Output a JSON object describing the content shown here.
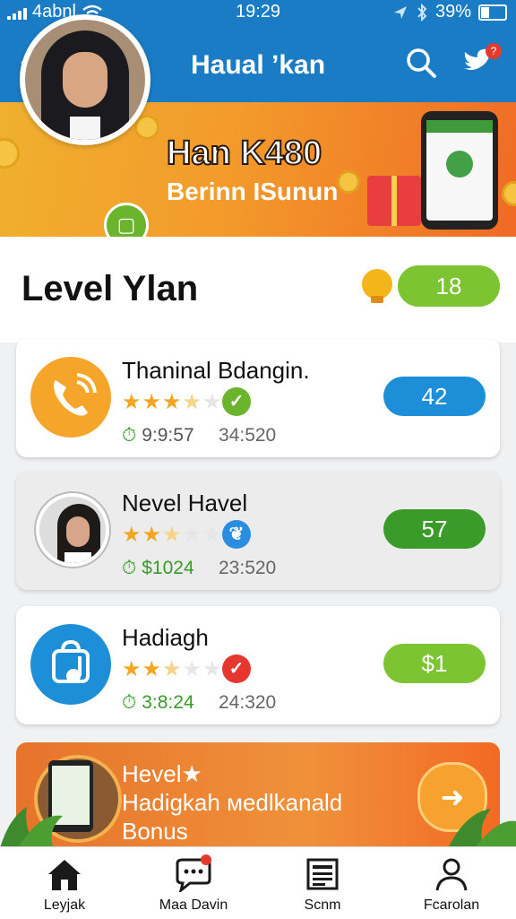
{
  "status_bar": {
    "carrier": "4abnl",
    "time": "19:29",
    "battery": "39%"
  },
  "header": {
    "title": "Haual ʼkan",
    "notification_count": "?"
  },
  "banner": {
    "title": "Han K480",
    "subtitle": "Berinn ISunun"
  },
  "level": {
    "title": "Level Ylan",
    "value": "18"
  },
  "cards": [
    {
      "name": "Thaninal Bdangin.",
      "rating": 3.5,
      "stat1": "9:9:57",
      "stat2": "34:520",
      "score": "42",
      "score_color": "#1c8fd8",
      "badge_color": "#6ab42e",
      "icon": "phone-icon"
    },
    {
      "name": "Nevel Havel",
      "rating": 2.5,
      "stat1": "$1024",
      "stat2": "23:520",
      "score": "57",
      "score_color": "#3a9a2a",
      "badge_color": "#2a8ee0",
      "icon": "user-avatar"
    },
    {
      "name": "Hadiagh",
      "rating": 2.5,
      "stat1": "3:8:24",
      "stat2": "24:320",
      "score": "$1",
      "score_color": "#7cc432",
      "badge_color": "#e5372f",
      "icon": "music-bag-icon"
    }
  ],
  "promo": {
    "line1": "Hevel★",
    "line2": "Hadigkah мedlkanald",
    "line3": "Bonus"
  },
  "nav": [
    {
      "label": "Leyjak",
      "icon": "home-icon"
    },
    {
      "label": "Maa Davin",
      "icon": "chat-icon"
    },
    {
      "label": "Scnm",
      "icon": "news-icon"
    },
    {
      "label": "Fcarolan",
      "icon": "profile-icon"
    }
  ],
  "colors": {
    "primary": "#1b7cc6",
    "accent_green": "#7cc432",
    "orange": "#f39a2b"
  }
}
